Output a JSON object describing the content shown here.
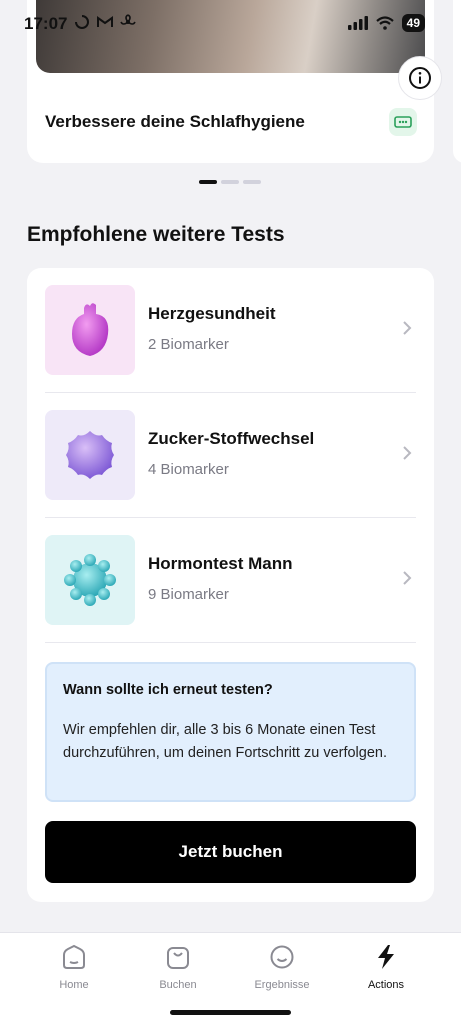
{
  "status_bar": {
    "time": "17:07",
    "battery": "49",
    "icons_left": [
      "activity-ring-icon",
      "gmail-icon",
      "fan-icon"
    ],
    "icons_right": [
      "cellular-signal-icon",
      "wifi-icon"
    ]
  },
  "top_card": {
    "title": "Verbessere deine Schlafhygiene",
    "info_icon": "info-icon",
    "badge_icon": "ticket-icon"
  },
  "carousel": {
    "page_count": 3,
    "active_index": 0
  },
  "section": {
    "title": "Empfohlene weitere Tests"
  },
  "tests": [
    {
      "name": "Herzgesundheit",
      "biomarkers": "2 Biomarker",
      "icon": "heart-icon",
      "thumb_color": "#f8e4f6"
    },
    {
      "name": "Zucker-Stoffwechsel",
      "biomarkers": "4 Biomarker",
      "icon": "sugar-crystal-icon",
      "thumb_color": "#eeeaf9"
    },
    {
      "name": "Hormontest Mann",
      "biomarkers": "9 Biomarker",
      "icon": "hormone-molecule-icon",
      "thumb_color": "#dff4f5"
    }
  ],
  "info_box": {
    "title": "Wann sollte ich erneut testen?",
    "body": "Wir empfehlen dir, alle 3 bis 6 Monate einen Test durchzuführen, um deinen Fortschritt zu verfolgen."
  },
  "cta": {
    "label": "Jetzt buchen"
  },
  "nav": {
    "items": [
      {
        "label": "Home",
        "icon": "home-icon",
        "active": false
      },
      {
        "label": "Buchen",
        "icon": "shopping-bag-icon",
        "active": false
      },
      {
        "label": "Ergebnisse",
        "icon": "smiley-icon",
        "active": false
      },
      {
        "label": "Actions",
        "icon": "lightning-icon",
        "active": true
      }
    ]
  },
  "colors": {
    "background": "#f2f2f5",
    "card": "#ffffff",
    "cta": "#000000",
    "info_box": "#e2effd",
    "muted_text": "#7a7a84"
  }
}
